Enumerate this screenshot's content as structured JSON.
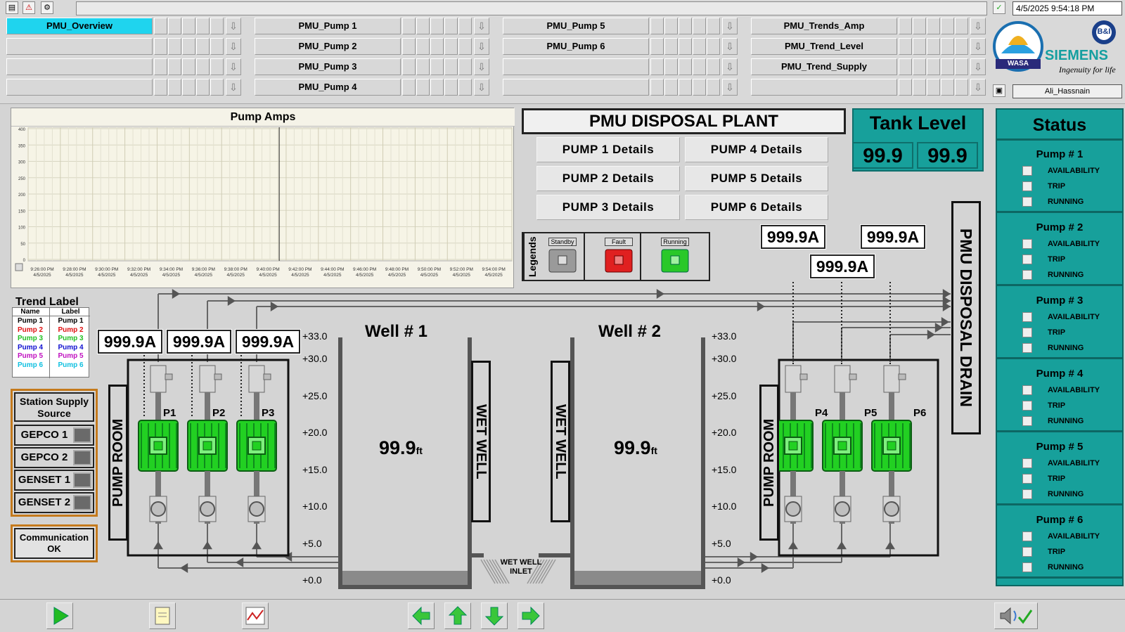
{
  "topbar": {
    "datetime": "4/5/2025 9:54:18 PM",
    "user": "Ali_Hassnain"
  },
  "nav": {
    "col1": [
      "PMU_Overview",
      "",
      "",
      ""
    ],
    "col2": [
      "PMU_Pump 1",
      "PMU_Pump 2",
      "PMU_Pump 3",
      "PMU_Pump 4"
    ],
    "col3": [
      "PMU_Pump 5",
      "PMU_Pump 6",
      "",
      ""
    ],
    "col4": [
      "PMU_Trends_Amp",
      "PMU_Trend_Level",
      "PMU_Trend_Supply",
      ""
    ]
  },
  "logos": {
    "wasa": "WASA",
    "siemens": "SIEMENS",
    "siemens_tag": "Ingenuity for life",
    "bi": "B&I"
  },
  "chart_data": {
    "type": "line",
    "title": "Pump Amps",
    "ylim": [
      0,
      400
    ],
    "yticks": [
      "400",
      "350",
      "300",
      "250",
      "200",
      "150",
      "100",
      "50",
      "0"
    ],
    "xticks": [
      {
        "time": "9:26:00 PM",
        "date": "4/5/2025"
      },
      {
        "time": "9:28:00 PM",
        "date": "4/5/2025"
      },
      {
        "time": "9:30:00 PM",
        "date": "4/5/2025"
      },
      {
        "time": "9:32:00 PM",
        "date": "4/5/2025"
      },
      {
        "time": "9:34:00 PM",
        "date": "4/5/2025"
      },
      {
        "time": "9:36:00 PM",
        "date": "4/5/2025"
      },
      {
        "time": "9:38:00 PM",
        "date": "4/5/2025"
      },
      {
        "time": "9:40:00 PM",
        "date": "4/5/2025"
      },
      {
        "time": "9:42:00 PM",
        "date": "4/5/2025"
      },
      {
        "time": "9:44:00 PM",
        "date": "4/5/2025"
      },
      {
        "time": "9:46:00 PM",
        "date": "4/5/2025"
      },
      {
        "time": "9:48:00 PM",
        "date": "4/5/2025"
      },
      {
        "time": "9:50:00 PM",
        "date": "4/5/2025"
      },
      {
        "time": "9:52:00 PM",
        "date": "4/5/2025"
      },
      {
        "time": "9:54:00 PM",
        "date": "4/5/2025"
      }
    ],
    "cursor_time": "9:41:00 PM",
    "series": [],
    "grid": true
  },
  "plant": {
    "title": "PMU DISPOSAL PLANT",
    "details": [
      "PUMP 1 Details",
      "PUMP 4 Details",
      "PUMP 2 Details",
      "PUMP 5 Details",
      "PUMP 3 Details",
      "PUMP 6 Details"
    ],
    "drain": "PMU DISPOSAL DRAIN"
  },
  "tank": {
    "title": "Tank Level",
    "values": [
      "99.9",
      "99.9"
    ]
  },
  "status": {
    "title": "Status",
    "pumps": [
      {
        "name": "Pump # 1",
        "items": [
          "AVAILABILITY",
          "TRIP",
          "RUNNING"
        ]
      },
      {
        "name": "Pump # 2",
        "items": [
          "AVAILABILITY",
          "TRIP",
          "RUNNING"
        ]
      },
      {
        "name": "Pump # 3",
        "items": [
          "AVAILABILITY",
          "TRIP",
          "RUNNING"
        ]
      },
      {
        "name": "Pump # 4",
        "items": [
          "AVAILABILITY",
          "TRIP",
          "RUNNING"
        ]
      },
      {
        "name": "Pump # 5",
        "items": [
          "AVAILABILITY",
          "TRIP",
          "RUNNING"
        ]
      },
      {
        "name": "Pump # 6",
        "items": [
          "AVAILABILITY",
          "TRIP",
          "RUNNING"
        ]
      }
    ]
  },
  "legends": {
    "title": "Legends",
    "items": [
      "Standby",
      "Fault",
      "Running"
    ],
    "colors": [
      "#9a9a9a",
      "#e02020",
      "#29c829"
    ]
  },
  "amps": {
    "p1": "999.9A",
    "p2": "999.9A",
    "p3": "999.9A",
    "p4": "999.9A",
    "p5": "999.9A",
    "p6": "999.9A"
  },
  "trend_label": {
    "title": "Trend Label",
    "headers": [
      "Name",
      "Label"
    ],
    "rows": [
      {
        "name": "Pump 1",
        "label": "Pump 1",
        "color": "#000000"
      },
      {
        "name": "Pump 2",
        "label": "Pump 2",
        "color": "#e01010"
      },
      {
        "name": "Pump 3",
        "label": "Pump 3",
        "color": "#22c022"
      },
      {
        "name": "Pump 4",
        "label": "Pump 4",
        "color": "#1010d0"
      },
      {
        "name": "Pump 5",
        "label": "Pump 5",
        "color": "#c010c0"
      },
      {
        "name": "Pump 6",
        "label": "Pump 6",
        "color": "#10c0e0"
      }
    ]
  },
  "station": {
    "title": "Station Supply Source",
    "sources": [
      "GEPCO 1",
      "GEPCO 2",
      "GENSET 1",
      "GENSET 2"
    ]
  },
  "comm": "Communication OK",
  "wells": {
    "well1": {
      "title": "Well # 1",
      "level": "99.9",
      "unit": "ft"
    },
    "well2": {
      "title": "Well # 2",
      "level": "99.9",
      "unit": "ft"
    },
    "wet_well": "WET WELL",
    "inlet": "WET WELL INLET",
    "scale": [
      "+33.0",
      "+30.0",
      "+25.0",
      "+20.0",
      "+15.0",
      "+10.0",
      "+5.0",
      "+0.0"
    ]
  },
  "pump_room": "PUMP ROOM",
  "pump_labels": [
    "P1",
    "P2",
    "P3",
    "P4",
    "P5",
    "P6"
  ]
}
